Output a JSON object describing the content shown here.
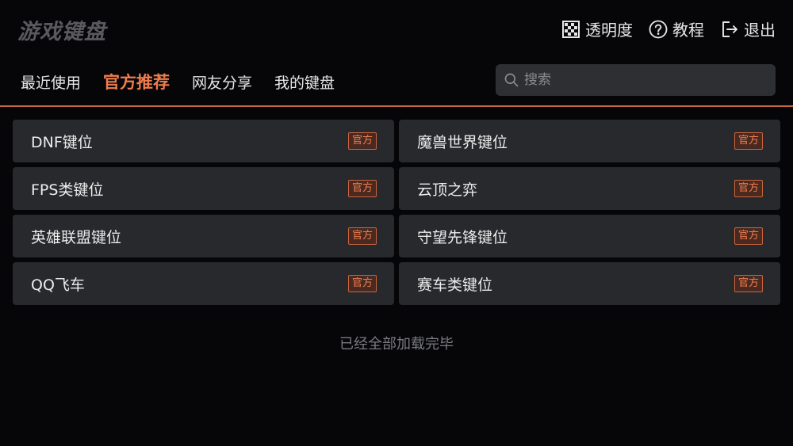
{
  "header": {
    "logo": "游戏键盘",
    "actions": [
      {
        "label": "透明度",
        "icon": "transparency-icon"
      },
      {
        "label": "教程",
        "icon": "help-icon"
      },
      {
        "label": "退出",
        "icon": "exit-icon"
      }
    ]
  },
  "tabs": [
    {
      "label": "最近使用",
      "active": false
    },
    {
      "label": "官方推荐",
      "active": true
    },
    {
      "label": "网友分享",
      "active": false
    },
    {
      "label": "我的键盘",
      "active": false
    }
  ],
  "search": {
    "placeholder": "搜索",
    "value": ""
  },
  "badge_label": "官方",
  "layouts": [
    {
      "name": "DNF键位"
    },
    {
      "name": "魔兽世界键位"
    },
    {
      "name": "FPS类键位"
    },
    {
      "name": "云顶之弈"
    },
    {
      "name": "英雄联盟键位"
    },
    {
      "name": "守望先锋键位"
    },
    {
      "name": "QQ飞车"
    },
    {
      "name": "赛车类键位"
    }
  ],
  "footer_note": "已经全部加载完毕",
  "colors": {
    "accent": "#ee7d4e",
    "card_bg": "#28292d",
    "background": "#060608"
  }
}
